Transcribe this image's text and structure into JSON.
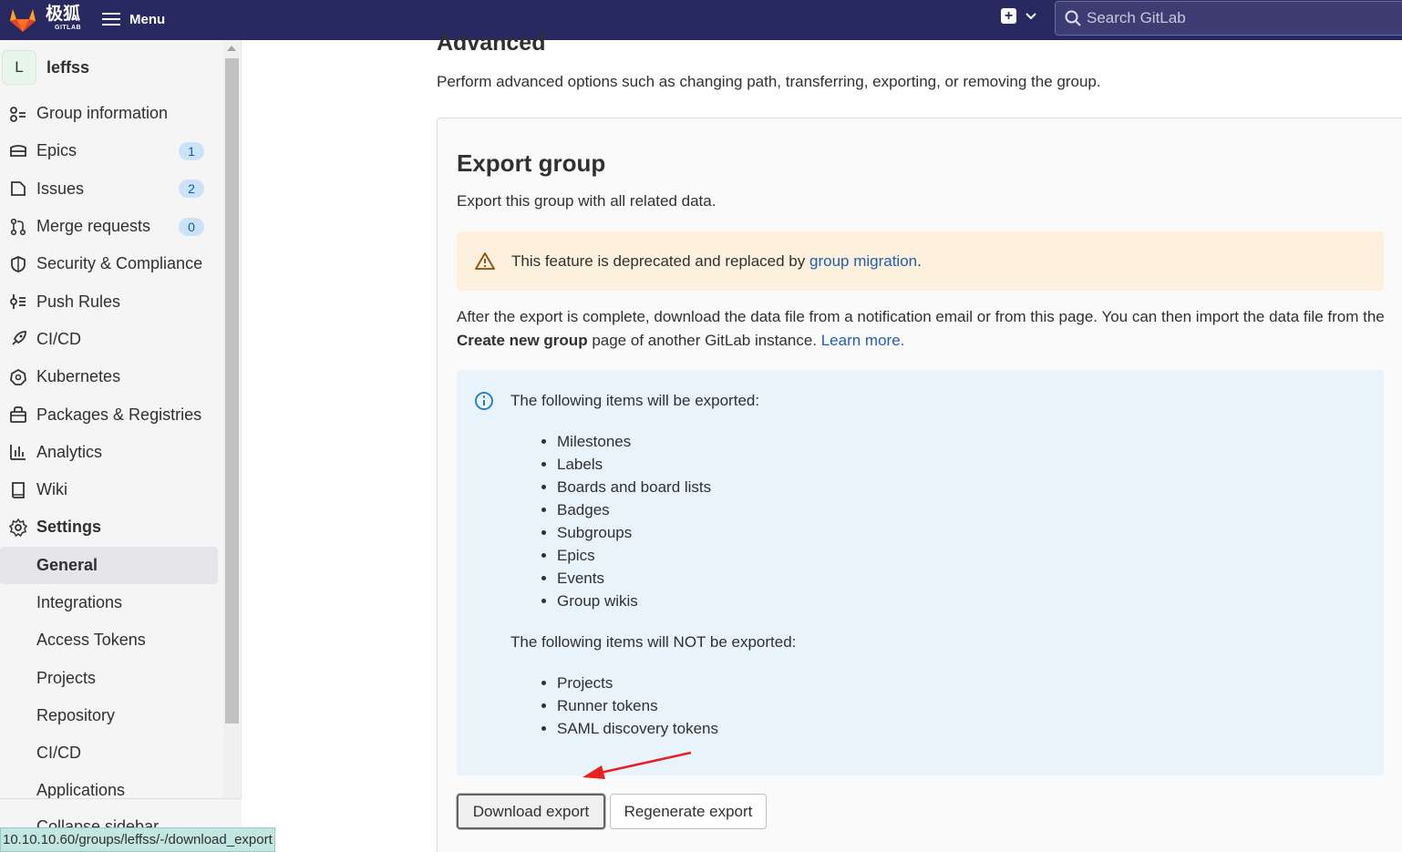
{
  "topbar": {
    "brand": "极狐",
    "brand_sub": "GITLAB",
    "menu_label": "Menu",
    "search_placeholder": "Search GitLab"
  },
  "sidebar": {
    "group_initial": "L",
    "group_name": "leffss",
    "items": [
      {
        "label": "Group information",
        "icon": "group-info-icon"
      },
      {
        "label": "Epics",
        "icon": "epic-icon",
        "badge": "1"
      },
      {
        "label": "Issues",
        "icon": "issues-icon",
        "badge": "2"
      },
      {
        "label": "Merge requests",
        "icon": "merge-request-icon",
        "badge": "0"
      },
      {
        "label": "Security & Compliance",
        "icon": "shield-icon"
      },
      {
        "label": "Push Rules",
        "icon": "push-rules-icon"
      },
      {
        "label": "CI/CD",
        "icon": "rocket-icon"
      },
      {
        "label": "Kubernetes",
        "icon": "kubernetes-icon"
      },
      {
        "label": "Packages & Registries",
        "icon": "package-icon"
      },
      {
        "label": "Analytics",
        "icon": "chart-icon"
      },
      {
        "label": "Wiki",
        "icon": "book-icon"
      },
      {
        "label": "Settings",
        "icon": "gear-icon"
      }
    ],
    "settings_sub": [
      "General",
      "Integrations",
      "Access Tokens",
      "Projects",
      "Repository",
      "CI/CD",
      "Applications"
    ],
    "collapse_label": "Collapse sidebar"
  },
  "status_url": "10.10.10.60/groups/leffss/-/download_export",
  "main": {
    "advanced_title": "Advanced",
    "advanced_desc": "Perform advanced options such as changing path, transferring, exporting, or removing the group.",
    "export_title": "Export group",
    "export_desc": "Export this group with all related data.",
    "warning_text": "This feature is deprecated and replaced by ",
    "warning_link": "group migration",
    "warning_end": ".",
    "after_text_1": "After the export is complete, download the data file from a notification email or from this page. You can then import the data file from the ",
    "after_bold": "Create new group",
    "after_text_2": " page of another GitLab instance. ",
    "learn_more": "Learn more.",
    "exported_heading": "The following items will be exported:",
    "exported_items": [
      "Milestones",
      "Labels",
      "Boards and board lists",
      "Badges",
      "Subgroups",
      "Epics",
      "Events",
      "Group wikis"
    ],
    "not_exported_heading": "The following items will NOT be exported:",
    "not_exported_items": [
      "Projects",
      "Runner tokens",
      "SAML discovery tokens"
    ],
    "download_button": "Download export",
    "regenerate_button": "Regenerate export"
  },
  "colors": {
    "topbar": "#292961",
    "link": "#1f5fb2",
    "warning_bg": "#fdf1dd",
    "info_bg": "#e9f3fc",
    "annotation_arrow": "#e8201f"
  }
}
